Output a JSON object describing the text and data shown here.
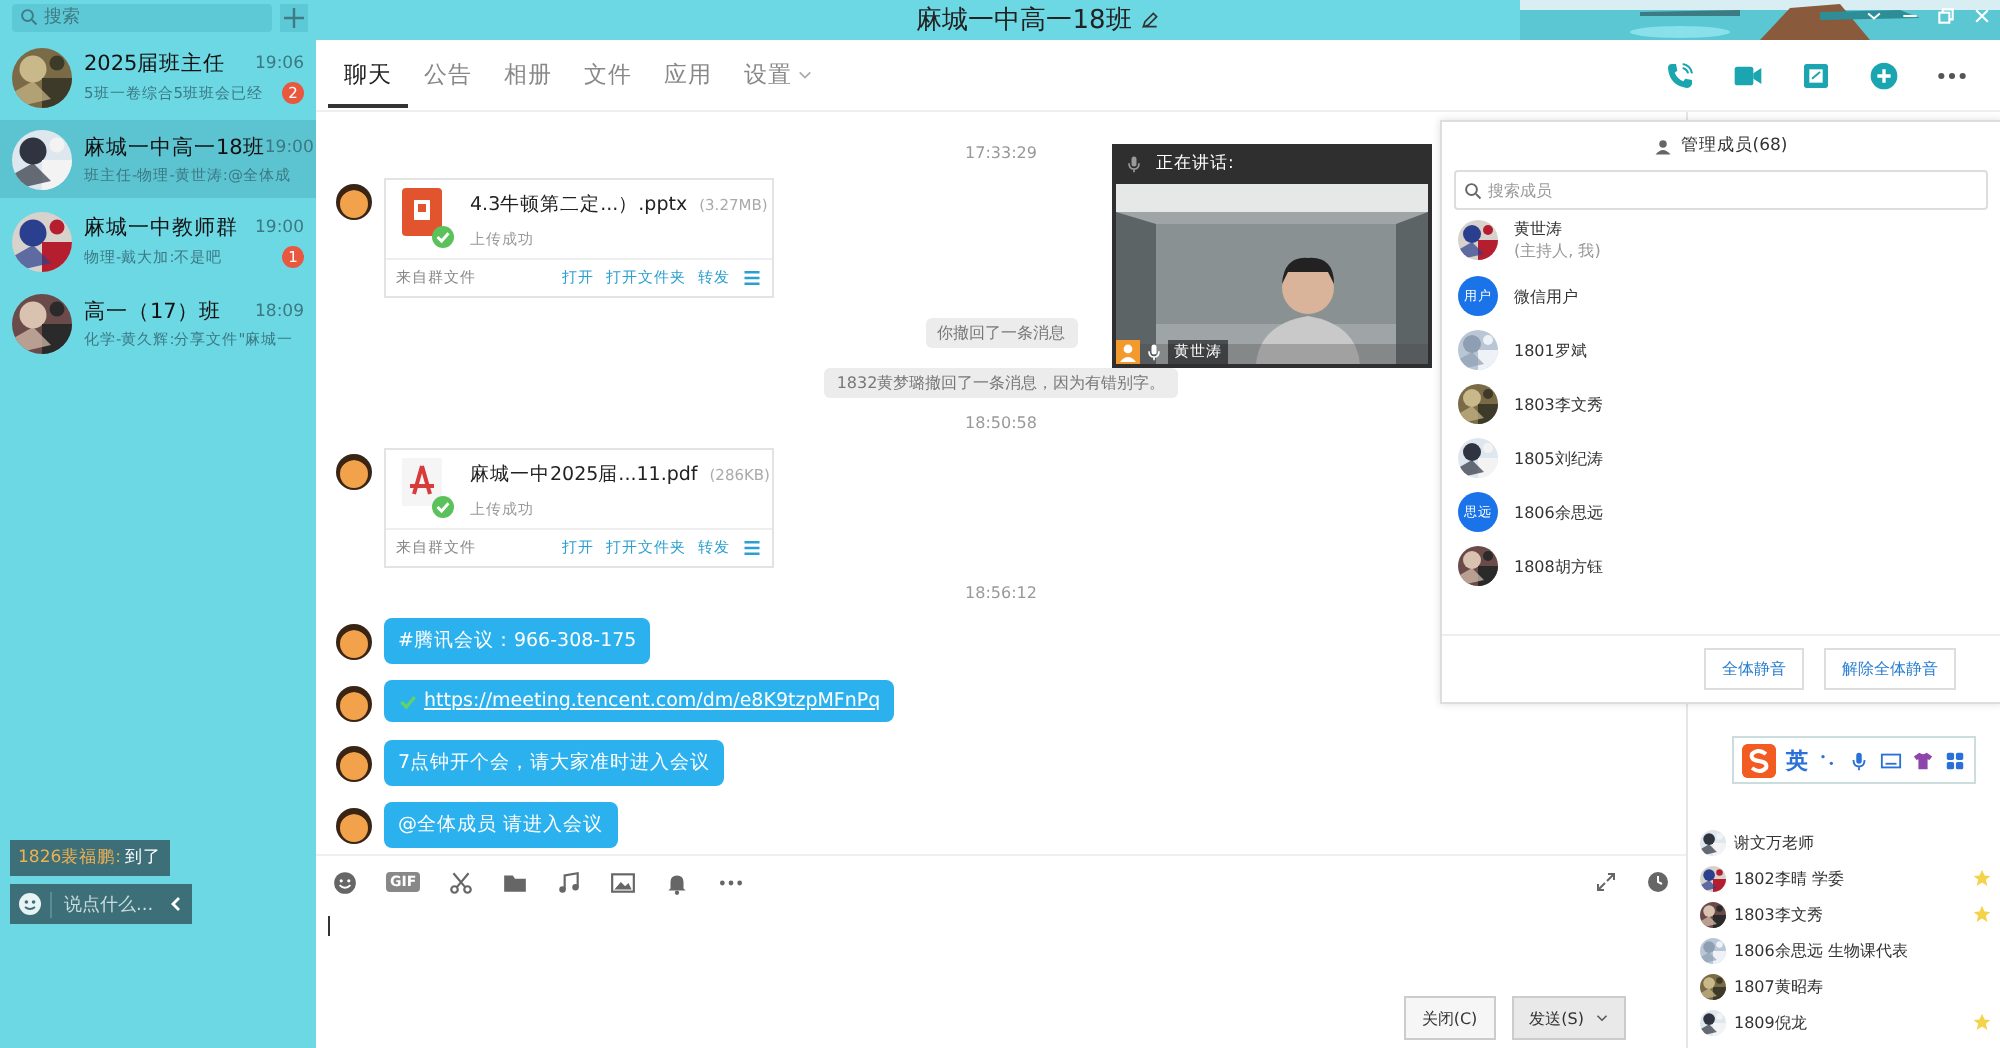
{
  "sidebar": {
    "search": {
      "placeholder": "搜索"
    },
    "chats": [
      {
        "name": "2025届班主任",
        "time": "19:06",
        "preview": "5班一卷综合5班班会已经",
        "unread": "2",
        "selected": false
      },
      {
        "name": "麻城一中高一18班",
        "time": "19:00",
        "preview": "班主任-物理-黄世涛:@全体成",
        "selected": true
      },
      {
        "name": "麻城一中教师群",
        "time": "19:00",
        "preview": "物理-戴大加:不是吧",
        "unread": "1",
        "selected": false
      },
      {
        "name": "高一（17）班",
        "time": "18:09",
        "preview": "化学-黄久辉:分享文件\"麻城一",
        "selected": false
      }
    ],
    "ticker": {
      "sender": "1826裴福鹏:",
      "text": "到了"
    },
    "comment": {
      "placeholder": "说点什么..."
    }
  },
  "header": {
    "title": "麻城一中高一18班"
  },
  "tabs": [
    {
      "label": "聊天",
      "selected": true,
      "dropdown": false
    },
    {
      "label": "公告",
      "selected": false,
      "dropdown": false
    },
    {
      "label": "相册",
      "selected": false,
      "dropdown": false
    },
    {
      "label": "文件",
      "selected": false,
      "dropdown": false
    },
    {
      "label": "应用",
      "selected": false,
      "dropdown": false
    },
    {
      "label": "设置",
      "selected": false,
      "dropdown": true
    }
  ],
  "messages": [
    {
      "kind": "time",
      "text": "17:33:29"
    },
    {
      "kind": "ppt_file",
      "filename": "4.3牛顿第二定...）.pptx",
      "size": "(3.27MB)",
      "status": "上传成功",
      "source": "来自群文件",
      "actions": [
        "打开",
        "打开文件夹",
        "转发"
      ]
    },
    {
      "kind": "notice",
      "text": "你撤回了一条消息"
    },
    {
      "kind": "notice",
      "text": "1832黄梦璐撤回了一条消息，因为有错别字。"
    },
    {
      "kind": "time",
      "text": "18:50:58"
    },
    {
      "kind": "pdf_file",
      "filename": "麻城一中2025届...11.pdf",
      "size": "(286KB)",
      "status": "上传成功",
      "source": "来自群文件",
      "actions": [
        "打开",
        "打开文件夹",
        "转发"
      ]
    },
    {
      "kind": "time",
      "text": "18:56:12"
    },
    {
      "kind": "text",
      "text": "#腾讯会议：966-308-175"
    },
    {
      "kind": "link",
      "text": "https://meeting.tencent.com/dm/e8K9tzpMFnPq"
    },
    {
      "kind": "text",
      "text": "7点钟开个会，请大家准时进入会议"
    },
    {
      "kind": "text",
      "text": "@全体成员 请进入会议"
    }
  ],
  "input_toolbar": {
    "gif": "GIF"
  },
  "buttons": [
    {
      "label": "关闭(C)",
      "dropdown": false
    },
    {
      "label": "发送(S)",
      "dropdown": true
    }
  ],
  "video": {
    "heading": "正在讲话:",
    "speaker": "黄世涛"
  },
  "members_popup": {
    "title": "管理成员(68)",
    "search": {
      "placeholder": "搜索成员"
    },
    "members": [
      {
        "name": "黄世涛",
        "role": "(主持人, 我)"
      },
      {
        "name": "微信用户",
        "kind": "initials",
        "initials": "用户"
      },
      {
        "name": "1801罗斌"
      },
      {
        "name": "1803李文秀"
      },
      {
        "name": "1805刘纪涛"
      },
      {
        "name": "1806余思远",
        "kind": "initials",
        "initials": "思远"
      },
      {
        "name": "1808胡方钰"
      }
    ],
    "buttons": [
      "全体静音",
      "解除全体静音"
    ]
  },
  "ime": {
    "mode": "英"
  },
  "member_list": [
    {
      "name": "谢文万老师",
      "starred": false
    },
    {
      "name": "1802李晴 学委",
      "starred": true
    },
    {
      "name": "1803李文秀",
      "starred": true
    },
    {
      "name": "1806余思远 生物课代表",
      "starred": false
    },
    {
      "name": "1807黄昭寿",
      "starred": false
    },
    {
      "name": "1809倪龙",
      "starred": true
    }
  ]
}
